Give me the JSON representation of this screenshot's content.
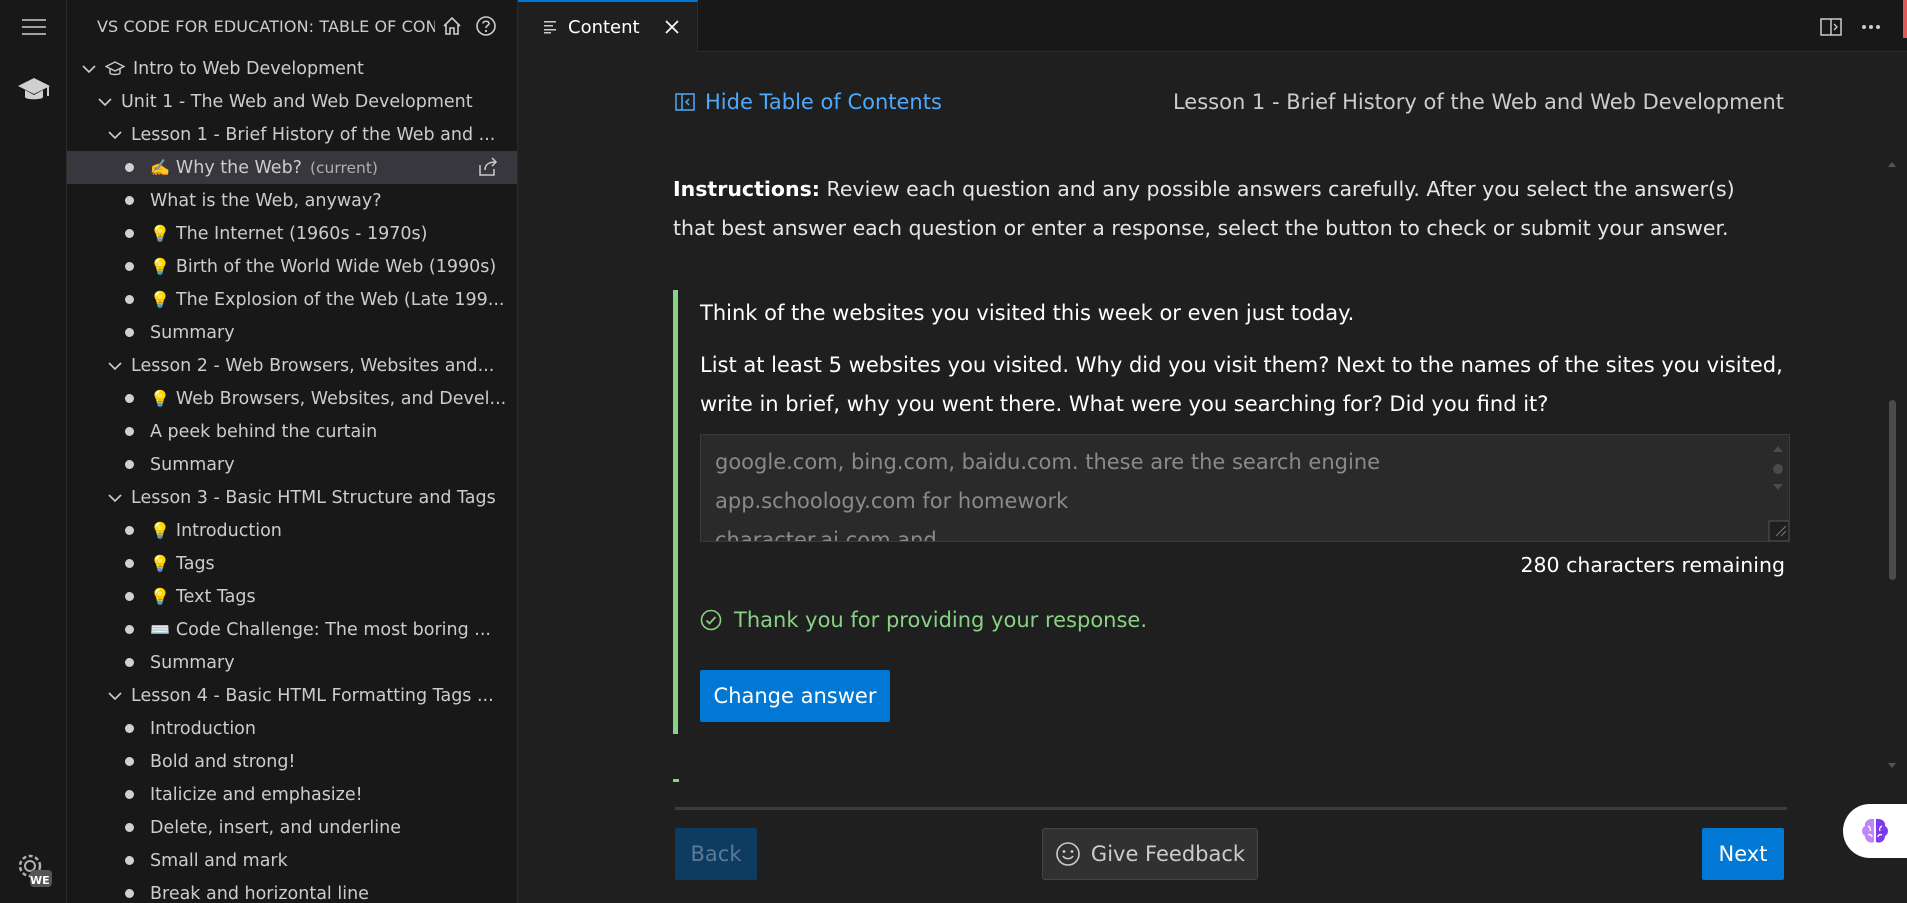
{
  "sidebar": {
    "title": "VS CODE FOR EDUCATION: TABLE OF CON...",
    "tree": [
      {
        "label": "Intro to Web Development",
        "level": 0,
        "kind": "course"
      },
      {
        "label": "Unit 1 - The Web and Web Development",
        "level": 1,
        "kind": "folder"
      },
      {
        "label": "Lesson 1 - Brief History of the Web and ...",
        "level": 2,
        "kind": "folder"
      },
      {
        "label": "Why the Web?",
        "level": 3,
        "kind": "page",
        "emoji": "✍️",
        "current": "(current)",
        "active": true
      },
      {
        "label": "What is the Web, anyway?",
        "level": 3,
        "kind": "page"
      },
      {
        "label": "The Internet (1960s - 1970s)",
        "level": 3,
        "kind": "page",
        "emoji": "💡"
      },
      {
        "label": "Birth of the World Wide Web (1990s)",
        "level": 3,
        "kind": "page",
        "emoji": "💡"
      },
      {
        "label": "The Explosion of the Web (Late 199...",
        "level": 3,
        "kind": "page",
        "emoji": "💡"
      },
      {
        "label": "Summary",
        "level": 3,
        "kind": "page"
      },
      {
        "label": "Lesson 2 - Web Browsers, Websites and...",
        "level": 2,
        "kind": "folder"
      },
      {
        "label": "Web Browsers, Websites, and Devel...",
        "level": 3,
        "kind": "page",
        "emoji": "💡"
      },
      {
        "label": "A peek behind the curtain",
        "level": 3,
        "kind": "page"
      },
      {
        "label": "Summary",
        "level": 3,
        "kind": "page"
      },
      {
        "label": "Lesson 3 - Basic HTML Structure and Tags",
        "level": 2,
        "kind": "folder"
      },
      {
        "label": "Introduction",
        "level": 3,
        "kind": "page",
        "emoji": "💡"
      },
      {
        "label": "Tags",
        "level": 3,
        "kind": "page",
        "emoji": "💡"
      },
      {
        "label": "Text Tags",
        "level": 3,
        "kind": "page",
        "emoji": "💡"
      },
      {
        "label": "Code Challenge: The most boring ...",
        "level": 3,
        "kind": "page",
        "emoji": "⌨️"
      },
      {
        "label": "Summary",
        "level": 3,
        "kind": "page"
      },
      {
        "label": "Lesson 4 - Basic HTML Formatting Tags ...",
        "level": 2,
        "kind": "folder"
      },
      {
        "label": "Introduction",
        "level": 3,
        "kind": "page"
      },
      {
        "label": "Bold and strong!",
        "level": 3,
        "kind": "page"
      },
      {
        "label": "Italicize and emphasize!",
        "level": 3,
        "kind": "page"
      },
      {
        "label": "Delete, insert, and underline",
        "level": 3,
        "kind": "page"
      },
      {
        "label": "Small and mark",
        "level": 3,
        "kind": "page"
      },
      {
        "label": "Break and horizontal line",
        "level": 3,
        "kind": "page"
      }
    ]
  },
  "activity": {
    "badge": "WE"
  },
  "tabs": {
    "content_label": "Content"
  },
  "content": {
    "hide_toc": "Hide Table of Contents",
    "lesson_title": "Lesson 1 - Brief History of the Web and Web Development",
    "instructions_bold": "Instructions:",
    "instructions_text": " Review each question and any possible answers carefully. After you select the answer(s) that best answer each question or enter a response, select the button to check or submit your answer.",
    "question_1": "Think of the websites you visited this week or even just today.",
    "question_2": "List at least 5 websites you visited. Why did you visit them? Next to the names of the sites you visited, write in brief, why you went there. What were you searching for? Did you find it?",
    "answer_text": "google.com, bing.com, baidu.com. these are the search engine\napp.schoology.com for homework\ncharacter.ai.com and",
    "chars_remaining": "280 characters remaining",
    "thanks": "Thank you for providing your response.",
    "change_answer": "Change answer",
    "back": "Back",
    "give_feedback": "Give Feedback",
    "next": "Next"
  },
  "colors": {
    "accent": "#0078d4",
    "success": "#89d185",
    "link": "#4daafc"
  }
}
